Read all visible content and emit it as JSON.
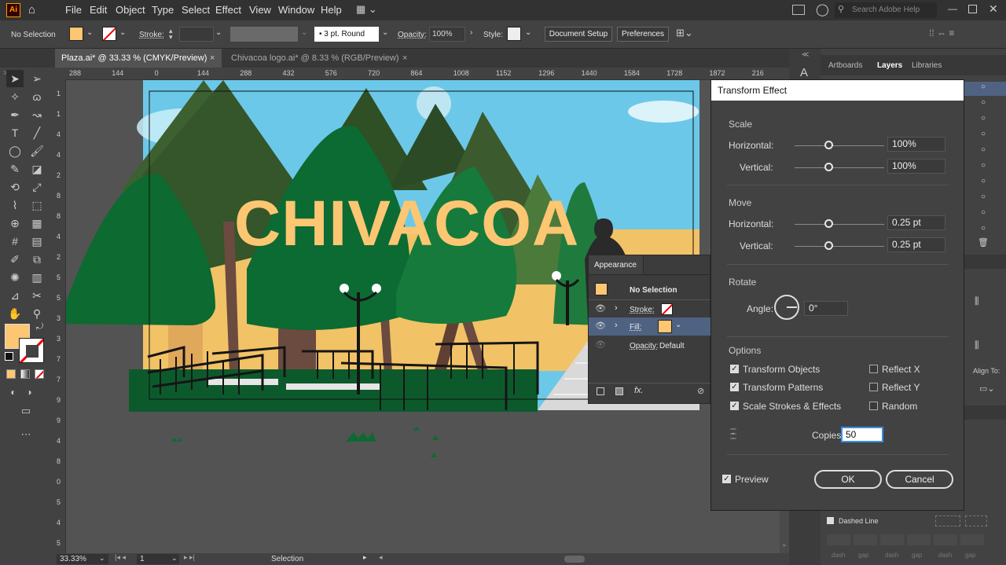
{
  "app": {
    "logo": "Ai"
  },
  "menu": [
    "File",
    "Edit",
    "Object",
    "Type",
    "Select",
    "Effect",
    "View",
    "Window",
    "Help"
  ],
  "search": {
    "placeholder": "Search Adobe Help"
  },
  "control": {
    "selection": "No Selection",
    "stroke_label": "Stroke:",
    "brush": "3 pt. Round",
    "opacity_label": "Opacity:",
    "opacity_value": "100%",
    "style_label": "Style:",
    "document_setup": "Document Setup",
    "preferences": "Preferences"
  },
  "tabs": [
    {
      "label": "Plaza.ai* @ 33.33 % (CMYK/Preview)"
    },
    {
      "label": "Chivacoa logo.ai* @ 8.33 % (RGB/Preview)"
    }
  ],
  "ruler_top": [
    "288",
    "144",
    "0",
    "144",
    "288",
    "432",
    "576",
    "720",
    "864",
    "1008",
    "1152",
    "1296",
    "1440",
    "1584",
    "1728",
    "1872",
    "216"
  ],
  "ruler_left": [
    "1",
    "1",
    "4",
    "4",
    "2",
    "8",
    "8",
    "4",
    "2",
    "5",
    "5",
    "3",
    "3",
    "7",
    "7",
    "9",
    "9",
    "4",
    "8",
    "0",
    "5",
    "4",
    "5"
  ],
  "artwork": {
    "headline": "CHIVACOA"
  },
  "colors": {
    "fill": "#fcc672",
    "sky": "#6cc8e8",
    "tree_dark": "#35552a",
    "tree_green": "#0c6a33",
    "wall": "#f2c266",
    "trunk": "#6b4a3f"
  },
  "appearance": {
    "title": "Appearance",
    "header": "No Selection",
    "stroke": "Stroke:",
    "fill": "Fill:",
    "opacity_label": "Opacity:",
    "opacity_value": "Default",
    "fx": "fx."
  },
  "right_panel": {
    "tabs": [
      "Artboards",
      "Layers",
      "Libraries"
    ],
    "active_tab": "Layers",
    "align_to": "Align To:",
    "dashed_line": "Dashed Line",
    "dash_labels": [
      "dash",
      "gap",
      "dash",
      "gap",
      "dash",
      "gap"
    ]
  },
  "dialog": {
    "title": "Transform Effect",
    "scale": {
      "label": "Scale",
      "horizontal": "Horizontal:",
      "horizontal_value": "100%",
      "vertical": "Vertical:",
      "vertical_value": "100%"
    },
    "move": {
      "label": "Move",
      "horizontal": "Horizontal:",
      "horizontal_value": "0.25 pt",
      "vertical": "Vertical:",
      "vertical_value": "0.25 pt"
    },
    "rotate": {
      "label": "Rotate",
      "angle": "Angle:",
      "angle_value": "0°"
    },
    "options": {
      "label": "Options",
      "transform_objects": "Transform Objects",
      "transform_patterns": "Transform Patterns",
      "scale_strokes": "Scale Strokes & Effects",
      "reflect_x": "Reflect X",
      "reflect_y": "Reflect Y",
      "random": "Random"
    },
    "copies_label": "Copies",
    "copies_value": "50",
    "preview": "Preview",
    "ok": "OK",
    "cancel": "Cancel"
  },
  "status": {
    "zoom": "33.33%",
    "artboard": "1",
    "tool": "Selection"
  }
}
